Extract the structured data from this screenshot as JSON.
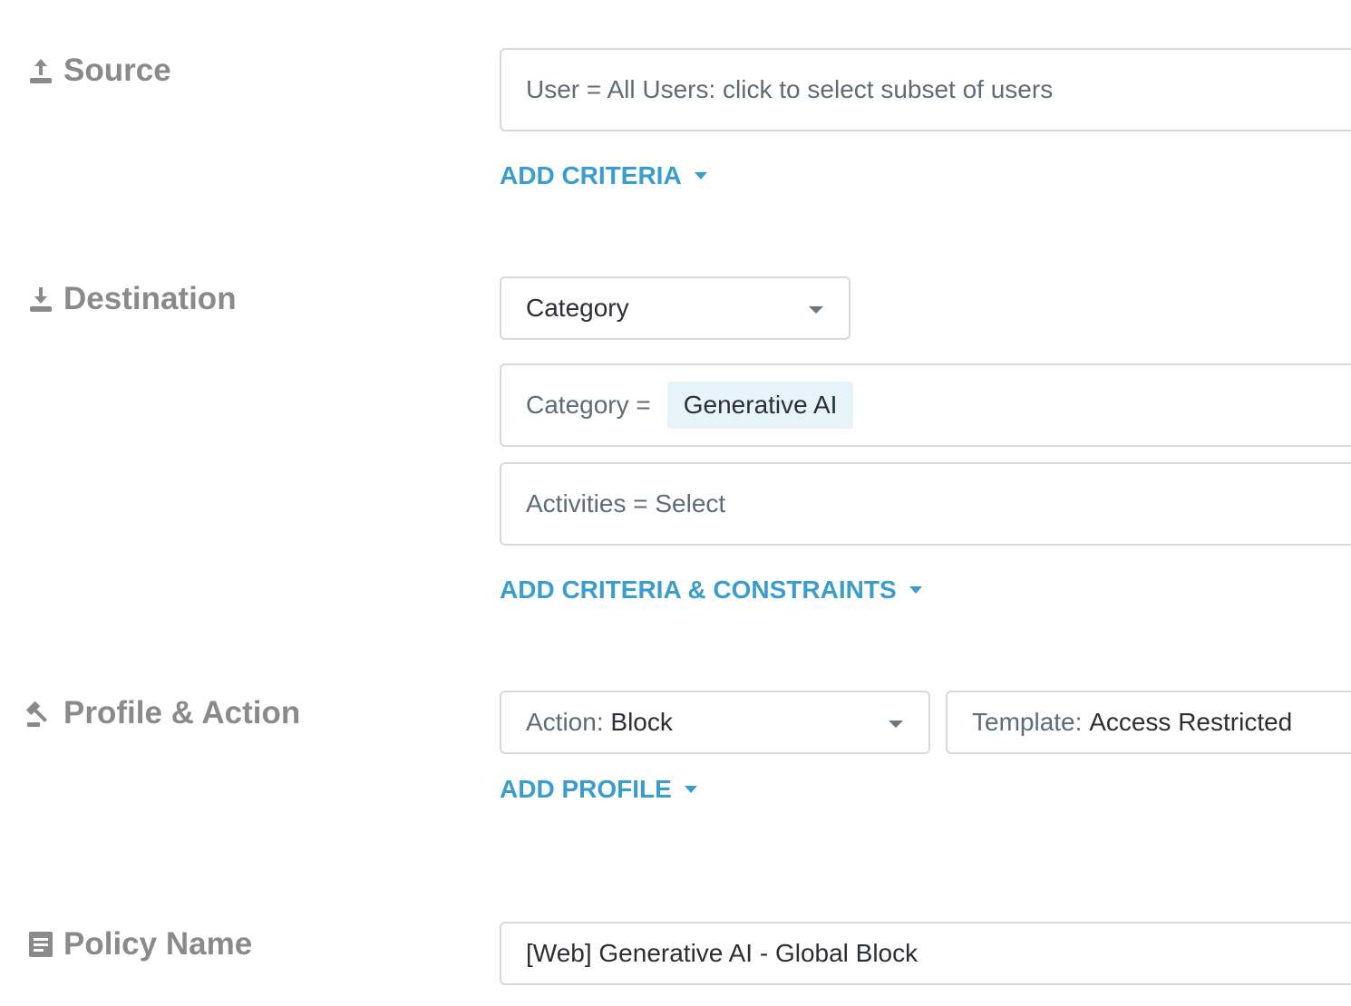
{
  "source": {
    "label": "Source",
    "icon": "upload-icon",
    "user_field": "User = All Users: click to select subset of users",
    "add_criteria": "ADD CRITERIA"
  },
  "destination": {
    "label": "Destination",
    "icon": "download-icon",
    "type_select": "Category",
    "category_prefix": "Category =",
    "category_chip": "Generative AI",
    "activities_field": "Activities = Select",
    "add_criteria_constraints": "ADD CRITERIA & CONSTRAINTS"
  },
  "profile_action": {
    "label": "Profile & Action",
    "icon": "gavel-icon",
    "action_prefix": "Action:",
    "action_value": "Block",
    "template_prefix": "Template:",
    "template_value": "Access Restricted",
    "add_profile": "ADD PROFILE"
  },
  "policy_name": {
    "label": "Policy Name",
    "icon": "document-icon",
    "value": "[Web] Generative AI - Global Block"
  },
  "colors": {
    "label_gray": "#8a8a8a",
    "link_blue": "#3a9dcc",
    "border": "#d7d9dc",
    "chip_bg": "#e6f4f9"
  }
}
